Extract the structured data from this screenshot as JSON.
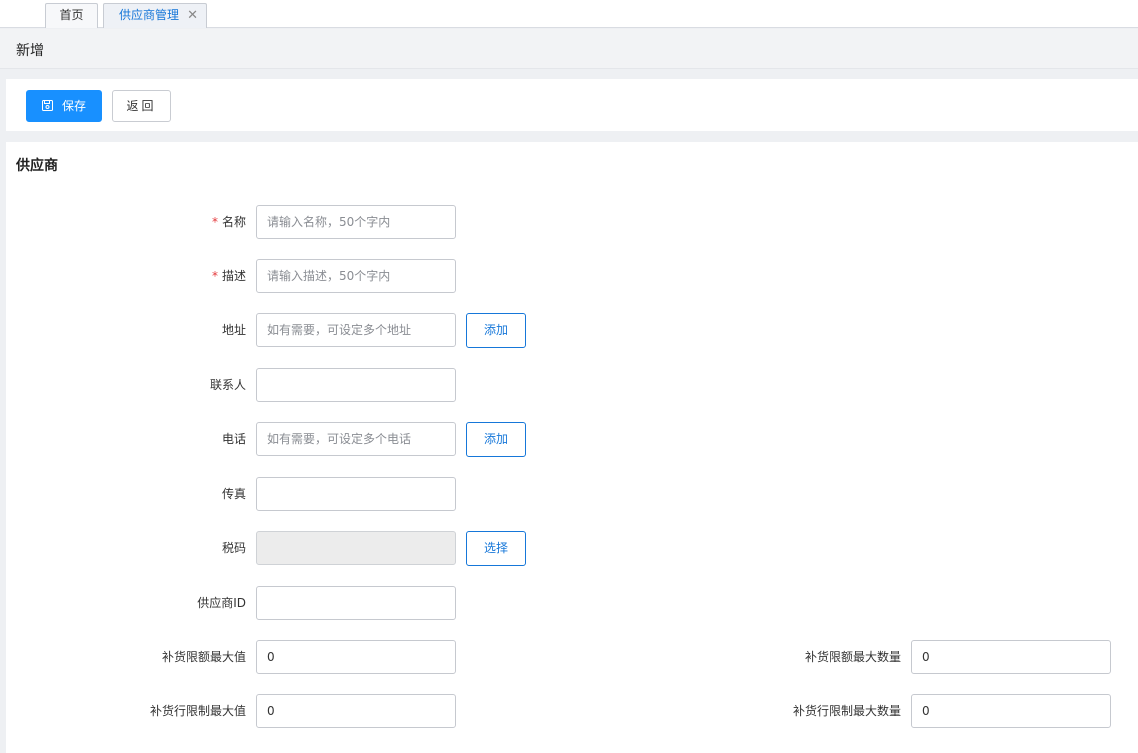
{
  "tabs": {
    "home": "首页",
    "active": "供应商管理",
    "close": "✕"
  },
  "header": {
    "title": "新增"
  },
  "toolbar": {
    "save_label": "保存",
    "back_label": "返回"
  },
  "form": {
    "section_title": "供应商",
    "required_mark": "*",
    "fields": {
      "name": {
        "label": "名称",
        "placeholder": "请输入名称，50个字内",
        "value": ""
      },
      "desc": {
        "label": "描述",
        "placeholder": "请输入描述，50个字内",
        "value": ""
      },
      "address": {
        "label": "地址",
        "placeholder": "如有需要，可设定多个地址",
        "button": "添加"
      },
      "contact": {
        "label": "联系人",
        "value": ""
      },
      "phone": {
        "label": "电话",
        "placeholder": "如有需要，可设定多个电话",
        "button": "添加"
      },
      "fax": {
        "label": "传真",
        "value": ""
      },
      "tax": {
        "label": "税码",
        "button": "选择"
      },
      "supplier_id": {
        "label": "供应商ID",
        "value": ""
      },
      "replenish_max_amount": {
        "label": "补货限额最大值",
        "value": "0"
      },
      "replenish_max_qty": {
        "label": "补货限额最大数量",
        "value": "0"
      },
      "line_max_amount": {
        "label": "补货行限制最大值",
        "value": "0"
      },
      "line_max_qty": {
        "label": "补货行限制最大数量",
        "value": "0"
      }
    }
  },
  "colors": {
    "primary": "#1890ff",
    "link": "#1677d9",
    "required": "#e4393c"
  }
}
